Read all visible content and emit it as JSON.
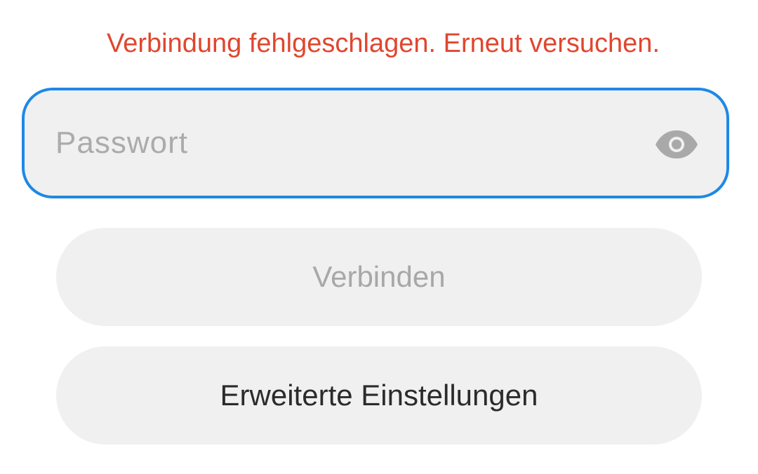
{
  "error": {
    "message": "Verbindung fehlgeschlagen. Erneut versuchen."
  },
  "password": {
    "value": "",
    "placeholder": "Passwort",
    "toggle_icon": "eye-icon"
  },
  "buttons": {
    "connect_label": "Verbinden",
    "advanced_label": "Erweiterte Einstellungen"
  },
  "colors": {
    "error": "#e0462f",
    "focus_border": "#1e88e5",
    "field_background": "#f0f0f0",
    "disabled_text": "#a8a8a8",
    "primary_text": "#2b2b2b"
  }
}
